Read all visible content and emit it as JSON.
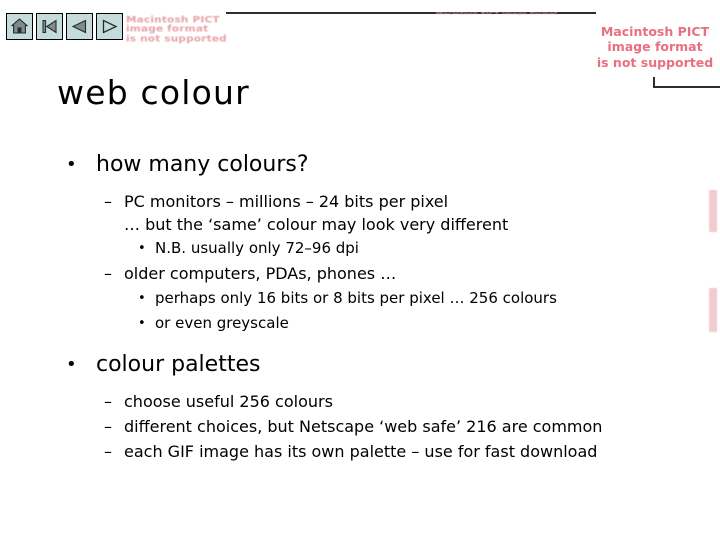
{
  "nav": {
    "buttons": [
      {
        "name": "home",
        "label": "Home"
      },
      {
        "name": "first-slide",
        "label": "First slide"
      },
      {
        "name": "previous-slide",
        "label": "Previous slide"
      },
      {
        "name": "next-slide",
        "label": "Next slide"
      }
    ]
  },
  "placeholders": {
    "pict_notice": "Macintosh PICT\nimage format\nis not supported",
    "pict_ghost_left": "Macintosh PICT\nimage format\nis not supported",
    "pict_ghost_top": "Macintosh PICT image format"
  },
  "slide": {
    "title": "web colour",
    "bullets": [
      {
        "level": 1,
        "marker": "•",
        "text": "how many colours?"
      },
      {
        "level": 2,
        "marker": "–",
        "text": "PC monitors – millions – 24 bits per pixel"
      },
      {
        "level": 2,
        "marker": "",
        "text": "… but the ‘same’ colour may look very different"
      },
      {
        "level": 3,
        "marker": "•",
        "text": "N.B. usually only 72–96 dpi"
      },
      {
        "level": 2,
        "marker": "–",
        "text": "older computers, PDAs, phones …"
      },
      {
        "level": 3,
        "marker": "•",
        "text": "perhaps only 16 bits or 8 bits per pixel … 256 colours"
      },
      {
        "level": 3,
        "marker": "•",
        "text": "or even greyscale"
      },
      {
        "level": 1,
        "marker": "•",
        "text": "colour palettes"
      },
      {
        "level": 2,
        "marker": "–",
        "text": "choose useful 256 colours"
      },
      {
        "level": 2,
        "marker": "–",
        "text": "different choices, but Netscape ‘web safe’ 216 are common"
      },
      {
        "level": 2,
        "marker": "–",
        "text": "each GIF image has its own palette – use for fast download"
      }
    ]
  },
  "colors": {
    "nav_button_fill": "#c5dcdc",
    "nav_glyph": "#6b7a7a",
    "pict_text": "#e8707f",
    "rule": "#2d2d38",
    "text": "#000000"
  }
}
